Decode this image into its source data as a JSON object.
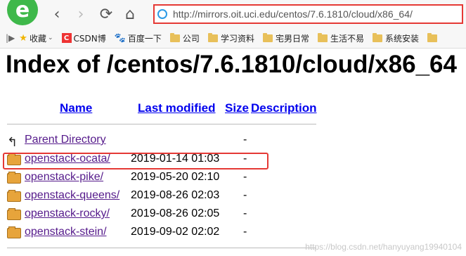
{
  "browser": {
    "logo_glyph": "e",
    "back_icon": "‹",
    "forward_icon": "›",
    "reload_icon": "⟳",
    "home_icon": "⌂",
    "url": "http://mirrors.oit.uci.edu/centos/7.6.1810/cloud/x86_64/",
    "bookmarks": [
      {
        "label": "收藏",
        "icon": "star-icon",
        "caret": "⌄"
      },
      {
        "label": "CSDN博",
        "icon": "csdn-icon"
      },
      {
        "label": "百度一下",
        "icon": "baidu-icon"
      },
      {
        "label": "公司",
        "icon": "folder-icon"
      },
      {
        "label": "学习资料",
        "icon": "folder-icon"
      },
      {
        "label": "宅男日常",
        "icon": "folder-icon"
      },
      {
        "label": "生活不易",
        "icon": "folder-icon"
      },
      {
        "label": "系统安装",
        "icon": "folder-icon"
      },
      {
        "label": "",
        "icon": "folder-icon"
      }
    ],
    "bookmark_prefix": "|▶"
  },
  "page": {
    "title": "Index of /centos/7.6.1810/cloud/x86_64",
    "columns": {
      "name": "Name",
      "last_modified": "Last modified",
      "size": "Size",
      "description": "Description"
    },
    "parent": {
      "label": "Parent Directory",
      "size": "-"
    },
    "entries": [
      {
        "name": "openstack-ocata/",
        "date": "2019-01-14 01:03",
        "size": "-"
      },
      {
        "name": "openstack-pike/",
        "date": "2019-05-20 02:10",
        "size": "-"
      },
      {
        "name": "openstack-queens/",
        "date": "2019-08-26 02:03",
        "size": "-"
      },
      {
        "name": "openstack-rocky/",
        "date": "2019-08-26 02:05",
        "size": "-"
      },
      {
        "name": "openstack-stein/",
        "date": "2019-09-02 02:02",
        "size": "-"
      }
    ],
    "watermark": "https://blog.csdn.net/hanyuyang19940104"
  },
  "colors": {
    "highlight": "#e53935",
    "link": "#0000ee",
    "visited": "#551a8b"
  }
}
